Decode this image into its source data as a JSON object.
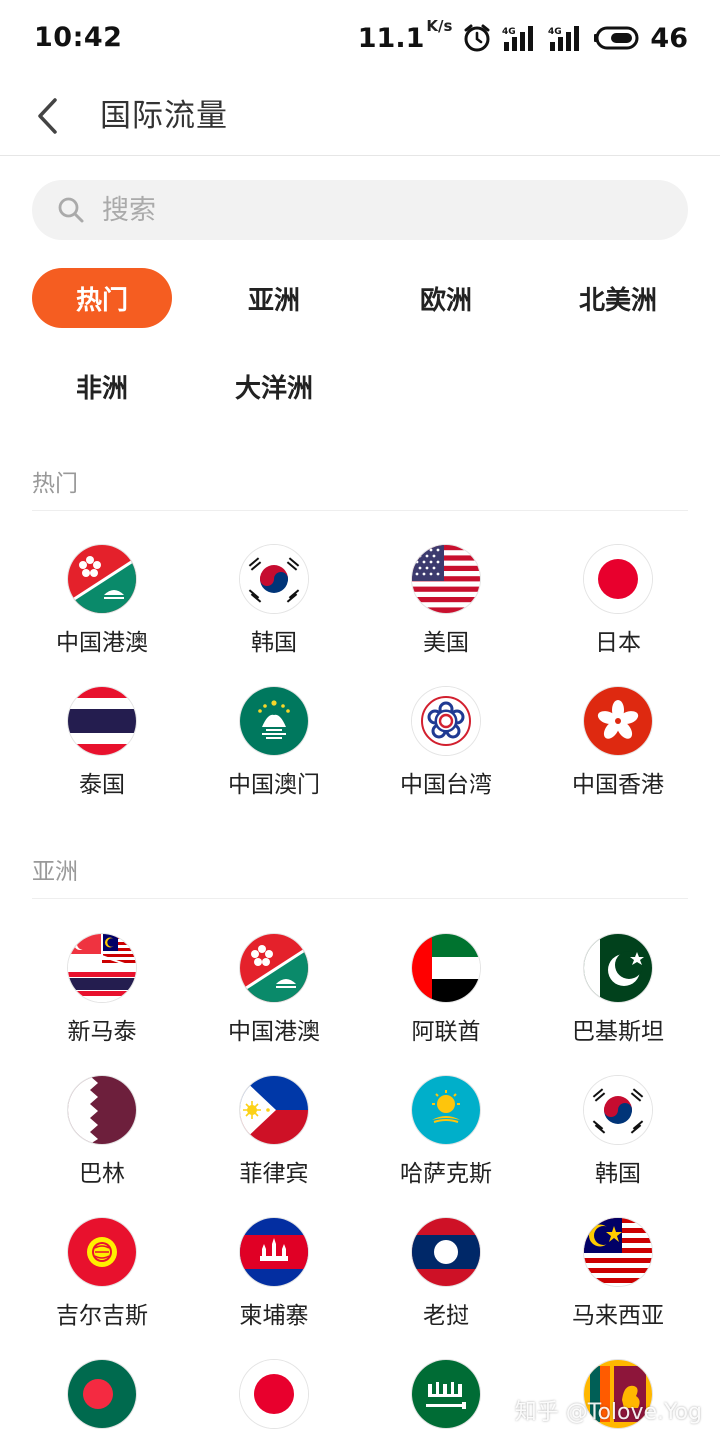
{
  "status_bar": {
    "time": "10:42",
    "net_speed": "11.1",
    "net_speed_unit": "K/s",
    "battery": "46"
  },
  "header": {
    "title": "国际流量"
  },
  "search": {
    "placeholder": "搜索"
  },
  "filters": [
    {
      "label": "热门",
      "active": true
    },
    {
      "label": "亚洲",
      "active": false
    },
    {
      "label": "欧洲",
      "active": false
    },
    {
      "label": "北美洲",
      "active": false
    },
    {
      "label": "非洲",
      "active": false
    },
    {
      "label": "大洋洲",
      "active": false
    }
  ],
  "sections": [
    {
      "title": "热门",
      "items": [
        {
          "name": "中国港澳",
          "flag": "hk-macau-flag"
        },
        {
          "name": "韩国",
          "flag": "korea-flag"
        },
        {
          "name": "美国",
          "flag": "usa-flag"
        },
        {
          "name": "日本",
          "flag": "japan-flag"
        },
        {
          "name": "泰国",
          "flag": "thailand-flag"
        },
        {
          "name": "中国澳门",
          "flag": "macau-flag"
        },
        {
          "name": "中国台湾",
          "flag": "taiwan-flag"
        },
        {
          "name": "中国香港",
          "flag": "hongkong-flag"
        }
      ]
    },
    {
      "title": "亚洲",
      "items": [
        {
          "name": "新马泰",
          "flag": "sg-my-th-flag"
        },
        {
          "name": "中国港澳",
          "flag": "hk-macau-flag"
        },
        {
          "name": "阿联酋",
          "flag": "uae-flag"
        },
        {
          "name": "巴基斯坦",
          "flag": "pakistan-flag"
        },
        {
          "name": "巴林",
          "flag": "bahrain-flag"
        },
        {
          "name": "菲律宾",
          "flag": "philippines-flag"
        },
        {
          "name": "哈萨克斯",
          "flag": "kazakhstan-flag"
        },
        {
          "name": "韩国",
          "flag": "korea-flag"
        },
        {
          "name": "吉尔吉斯",
          "flag": "kyrgyzstan-flag"
        },
        {
          "name": "柬埔寨",
          "flag": "cambodia-flag"
        },
        {
          "name": "老挝",
          "flag": "laos-flag"
        },
        {
          "name": "马来西亚",
          "flag": "malaysia-flag"
        },
        {
          "name": "",
          "flag": "bangladesh-flag"
        },
        {
          "name": "",
          "flag": "japan-flag"
        },
        {
          "name": "",
          "flag": "saudi-flag"
        },
        {
          "name": "",
          "flag": "srilanka-flag"
        }
      ]
    }
  ],
  "watermark": "知乎 @Tolove.Yog",
  "colors": {
    "accent": "#f55d21",
    "section_title": "#999999"
  }
}
